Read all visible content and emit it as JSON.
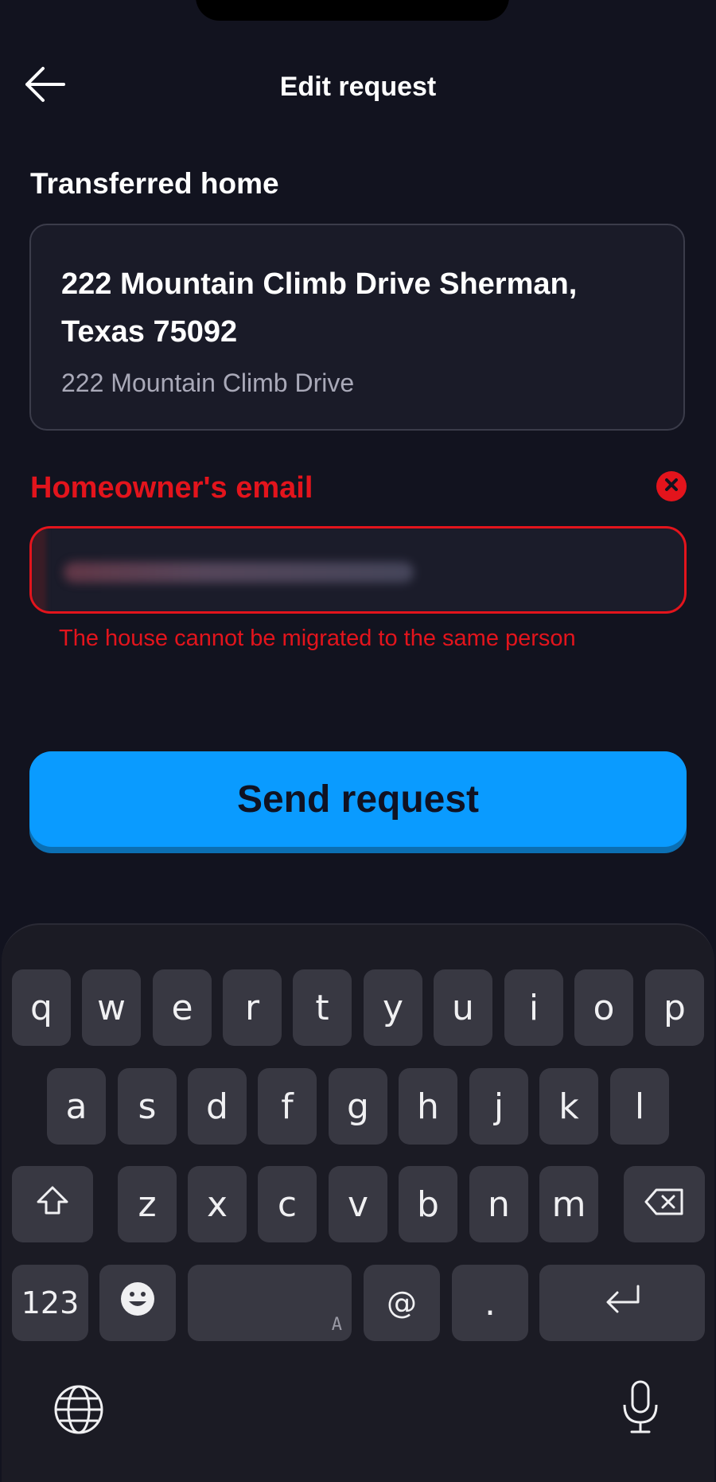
{
  "header": {
    "title": "Edit request",
    "back_icon": "arrow-left-icon"
  },
  "home": {
    "label": "Transferred home",
    "address_line1": "222 Mountain Climb Drive Sherman, Texas 75092",
    "address_line2": "222 Mountain Climb Drive"
  },
  "email": {
    "label": "Homeowner's email",
    "value": "",
    "error": "The house cannot be migrated to the same person",
    "clear_icon": "close-circle-icon"
  },
  "actions": {
    "send_label": "Send request"
  },
  "colors": {
    "background": "#12131f",
    "error": "#e3141c",
    "accent": "#0a9bff",
    "button_text": "#101222"
  },
  "keyboard": {
    "row1": [
      "q",
      "w",
      "e",
      "r",
      "t",
      "y",
      "u",
      "i",
      "o",
      "p"
    ],
    "row2": [
      "a",
      "s",
      "d",
      "f",
      "g",
      "h",
      "j",
      "k",
      "l"
    ],
    "row3": [
      "z",
      "x",
      "c",
      "v",
      "b",
      "n",
      "m"
    ],
    "numbers_label": "123",
    "space_hint": "A",
    "at_label": "@",
    "dot_label": ".",
    "icons": [
      "shift-icon",
      "backspace-icon",
      "emoji-icon",
      "return-icon",
      "globe-icon",
      "microphone-icon"
    ]
  }
}
